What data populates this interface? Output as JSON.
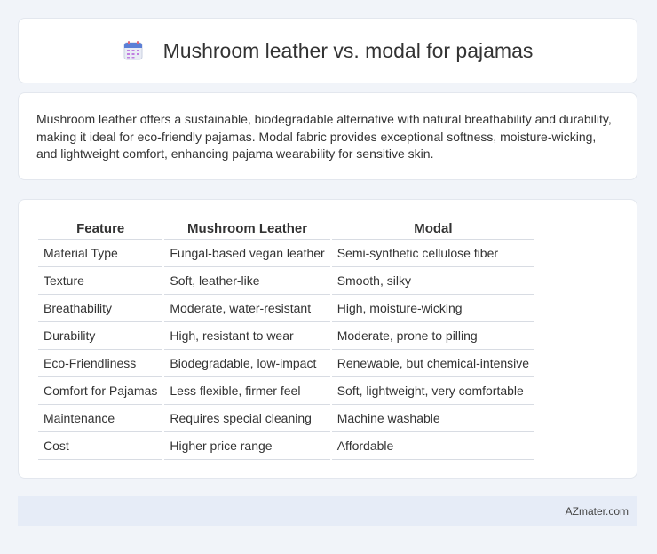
{
  "header": {
    "title": "Mushroom leather vs. modal for pajamas",
    "icon": "calendar-icon"
  },
  "intro": {
    "text": "Mushroom leather offers a sustainable, biodegradable alternative with natural breathability and durability, making it ideal for eco-friendly pajamas. Modal fabric provides exceptional softness, moisture-wicking, and lightweight comfort, enhancing pajama wearability for sensitive skin."
  },
  "table": {
    "headers": [
      "Feature",
      "Mushroom Leather",
      "Modal"
    ],
    "rows": [
      [
        "Material Type",
        "Fungal-based vegan leather",
        "Semi-synthetic cellulose fiber"
      ],
      [
        "Texture",
        "Soft, leather-like",
        "Smooth, silky"
      ],
      [
        "Breathability",
        "Moderate, water-resistant",
        "High, moisture-wicking"
      ],
      [
        "Durability",
        "High, resistant to wear",
        "Moderate, prone to pilling"
      ],
      [
        "Eco-Friendliness",
        "Biodegradable, low-impact",
        "Renewable, but chemical-intensive"
      ],
      [
        "Comfort for Pajamas",
        "Less flexible, firmer feel",
        "Soft, lightweight, very comfortable"
      ],
      [
        "Maintenance",
        "Requires special cleaning",
        "Machine washable"
      ],
      [
        "Cost",
        "Higher price range",
        "Affordable"
      ]
    ]
  },
  "footer": {
    "brand": "AZmater.com"
  }
}
